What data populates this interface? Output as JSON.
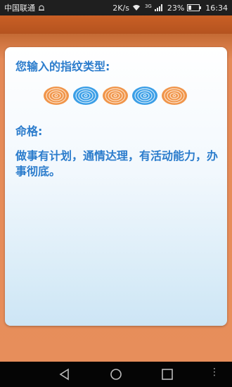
{
  "status_bar": {
    "carrier": "中国联通",
    "speed": "2K/s",
    "network": "3G",
    "battery": "23%",
    "time": "16:34"
  },
  "card": {
    "title": "您输入的指纹类型:",
    "fingerprints": [
      {
        "icon": "fingerprint-orange-icon",
        "color": "#f0954a"
      },
      {
        "icon": "fingerprint-blue-icon",
        "color": "#3a9ee6"
      },
      {
        "icon": "fingerprint-orange-icon",
        "color": "#f0954a"
      },
      {
        "icon": "fingerprint-blue-icon",
        "color": "#3a9ee6"
      },
      {
        "icon": "fingerprint-orange-icon",
        "color": "#f0954a"
      }
    ],
    "fate_label": "命格:",
    "fate_text": "做事有计划，通情达理，有活动能力，办事彻底。"
  },
  "colors": {
    "accent_text": "#2b7ccc",
    "app_bar": "#c95f25",
    "background": "#e58a57"
  }
}
